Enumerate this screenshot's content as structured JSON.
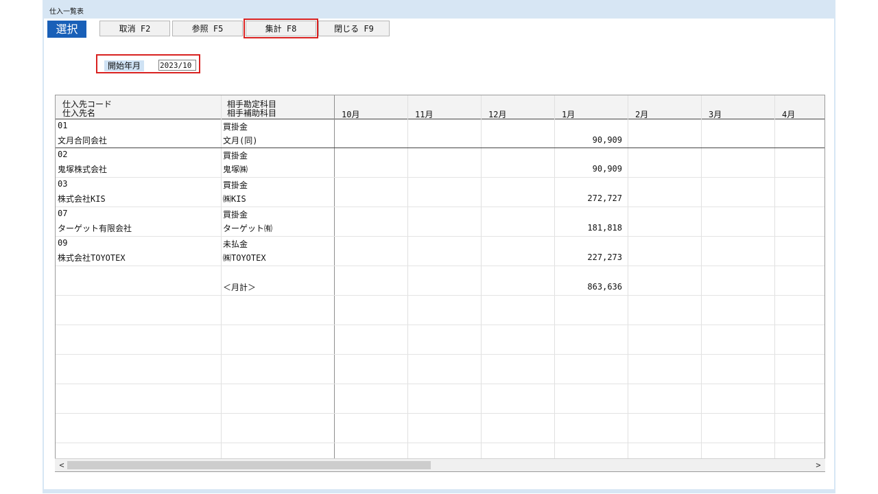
{
  "window": {
    "title": "仕入一覧表"
  },
  "toolbar": {
    "select": "選択",
    "cancel": "取消 F2",
    "reference": "参照 F5",
    "aggregate": "集計 F8",
    "close": "閉じる F9"
  },
  "filter": {
    "start_label": "開始年月",
    "start_value": "2023/10"
  },
  "table": {
    "header": {
      "supplier_code": "仕入先コード",
      "supplier_name": "仕入先名",
      "account": "相手勘定科目",
      "sub_account": "相手補助科目",
      "months": [
        "10月",
        "11月",
        "12月",
        "1月",
        "2月",
        "3月",
        "4月"
      ]
    },
    "rows": [
      {
        "code": "01",
        "name": "文月合同会社",
        "account": "買掛金",
        "sub": "文月(同)",
        "amounts": [
          "",
          "",
          "",
          "90,909",
          "",
          "",
          ""
        ]
      },
      {
        "code": "02",
        "name": "鬼塚株式会社",
        "account": "買掛金",
        "sub": "鬼塚㈱",
        "amounts": [
          "",
          "",
          "",
          "90,909",
          "",
          "",
          ""
        ]
      },
      {
        "code": "03",
        "name": "株式会社KIS",
        "account": "買掛金",
        "sub": "㈱KIS",
        "amounts": [
          "",
          "",
          "",
          "272,727",
          "",
          "",
          ""
        ]
      },
      {
        "code": "07",
        "name": "ターゲット有限会社",
        "account": "買掛金",
        "sub": "ターゲット㈲",
        "amounts": [
          "",
          "",
          "",
          "181,818",
          "",
          "",
          ""
        ]
      },
      {
        "code": "09",
        "name": "株式会社TOYOTEX",
        "account": "未払金",
        "sub": "㈱TOYOTEX",
        "amounts": [
          "",
          "",
          "",
          "227,273",
          "",
          "",
          ""
        ]
      },
      {
        "code": "",
        "name": "",
        "account": "",
        "sub": "＜月計＞",
        "amounts": [
          "",
          "",
          "",
          "863,636",
          "",
          "",
          ""
        ]
      },
      {
        "code": "",
        "name": "",
        "account": "",
        "sub": "",
        "amounts": [
          "",
          "",
          "",
          "",
          "",
          "",
          ""
        ]
      },
      {
        "code": "",
        "name": "",
        "account": "",
        "sub": "",
        "amounts": [
          "",
          "",
          "",
          "",
          "",
          "",
          ""
        ]
      },
      {
        "code": "",
        "name": "",
        "account": "",
        "sub": "",
        "amounts": [
          "",
          "",
          "",
          "",
          "",
          "",
          ""
        ]
      },
      {
        "code": "",
        "name": "",
        "account": "",
        "sub": "",
        "amounts": [
          "",
          "",
          "",
          "",
          "",
          "",
          ""
        ]
      },
      {
        "code": "",
        "name": "",
        "account": "",
        "sub": "",
        "amounts": [
          "",
          "",
          "",
          "",
          "",
          "",
          ""
        ]
      },
      {
        "code": "",
        "name": "",
        "account": "",
        "sub": "",
        "amounts": [
          "",
          "",
          "",
          "",
          "",
          "",
          ""
        ]
      }
    ]
  },
  "scrollbar": {
    "left_icon": "chevron-left-icon",
    "left_glyph": "<",
    "right_icon": "chevron-right-icon",
    "right_glyph": ">"
  }
}
